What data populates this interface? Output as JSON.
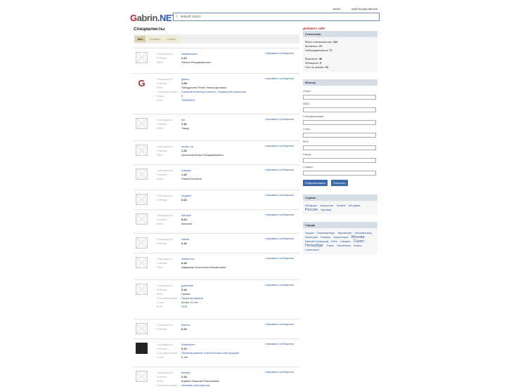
{
  "topnav": {
    "login": "войти",
    "register": "зарегистрироваться"
  },
  "logo": {
    "g": "G",
    "rest": "abrin",
    "net": ".NET"
  },
  "search": {
    "placeholder": "живой поиск"
  },
  "page_title": "Специалисты",
  "tabs": [
    {
      "label": "Все"
    },
    {
      "label": "Онлайн"
    },
    {
      "label": "Новые"
    }
  ],
  "labels": {
    "specialist": "Специалист:",
    "rating": "Рейтинг:",
    "fio": "ФИО:",
    "spec": "Специализация:",
    "exp": "Стаж:",
    "vuz": "ВУЗ:"
  },
  "send_message": "отправить сообщение",
  "cards": [
    {
      "login": "nikitaskotsov",
      "rating": "2.22",
      "fio": "Никита Владимирович"
    },
    {
      "login": "gtdsrs",
      "rating": "1.68",
      "fio": "Габидуллин Ренат Эмалутдинович",
      "spec": "Главный инженер проекта, Управление проектом",
      "exp": "5",
      "vuz": "ТИНИМСК",
      "letter": "G"
    },
    {
      "login": "tim",
      "rating": "1.36",
      "fio": "Тимур"
    },
    {
      "login": "murat_ha",
      "rating": "1.26",
      "fio": "Арсланов Марат Владимирович"
    },
    {
      "login": "roskype",
      "rating": "1.26",
      "fio": "Роман Белапин"
    },
    {
      "login": "riegabot",
      "rating": "0.64"
    },
    {
      "login": "Alexey9",
      "rating": "0.64",
      "fio": "Алексей"
    },
    {
      "login": "koknik",
      "rating": "0.43"
    },
    {
      "login": "Abdimova",
      "rating": "0.43",
      "fio": "Абдимова Анастасия Михайловна"
    },
    {
      "login": "gotienesh",
      "rating": "0.43",
      "fio": "Газиев",
      "spec": "Проектирование",
      "exp": "более 10 лет",
      "vuz": "ПНЛ"
    },
    {
      "login": "Marvin",
      "rating": "0.43"
    },
    {
      "login": "Vladexpert",
      "rating": "0.43",
      "spec": "Проектирование строительных конструкций",
      "exp": "6 лет",
      "dark": true
    },
    {
      "login": "barban",
      "rating": "0.43",
      "fio": "Барбан Николай Николаевич",
      "spec": "Инженер-конструктор"
    }
  ],
  "sidebar": {
    "add_me": "Добавить себя",
    "stats": {
      "title": "Статистика",
      "total_label": "Всего специалистов:",
      "total": "194",
      "active_label": "Активных:",
      "active": "37",
      "blocked_label": "Заблуждавшихся:",
      "blocked": "77",
      "men_label": "Мужчины:",
      "men": "38",
      "women_label": "Женщины:",
      "women": "5",
      "unknown_label": "Пол не указан:",
      "unknown": "63"
    },
    "filter": {
      "title": "Фильтр",
      "login": "Логин",
      "fio": "ФИО:",
      "spec": "Специализация:",
      "exp": "Стаж:",
      "vuz": "ВУЗ:",
      "city": "Город:",
      "country": "Страна:",
      "apply": "Отфильтровать",
      "clear": "Очистить"
    },
    "countries": {
      "title": "Страны",
      "items": [
        "Беларусь",
        "Казахстан",
        "Латвия",
        "Молдова",
        "Россия",
        "Украина"
      ]
    },
    "cities": {
      "title": "Города",
      "items": [
        "Гродно",
        "Екатеринбург",
        "Жуковский",
        "Калининград",
        "Кемерово",
        "Киевжа",
        "Красноярск",
        "Москва",
        "Нижний Новгород",
        "Рига",
        "Самара",
        "Санкт-Петербург",
        "Томск",
        "Челябинск",
        "Южно-Сахалинск"
      ]
    }
  }
}
